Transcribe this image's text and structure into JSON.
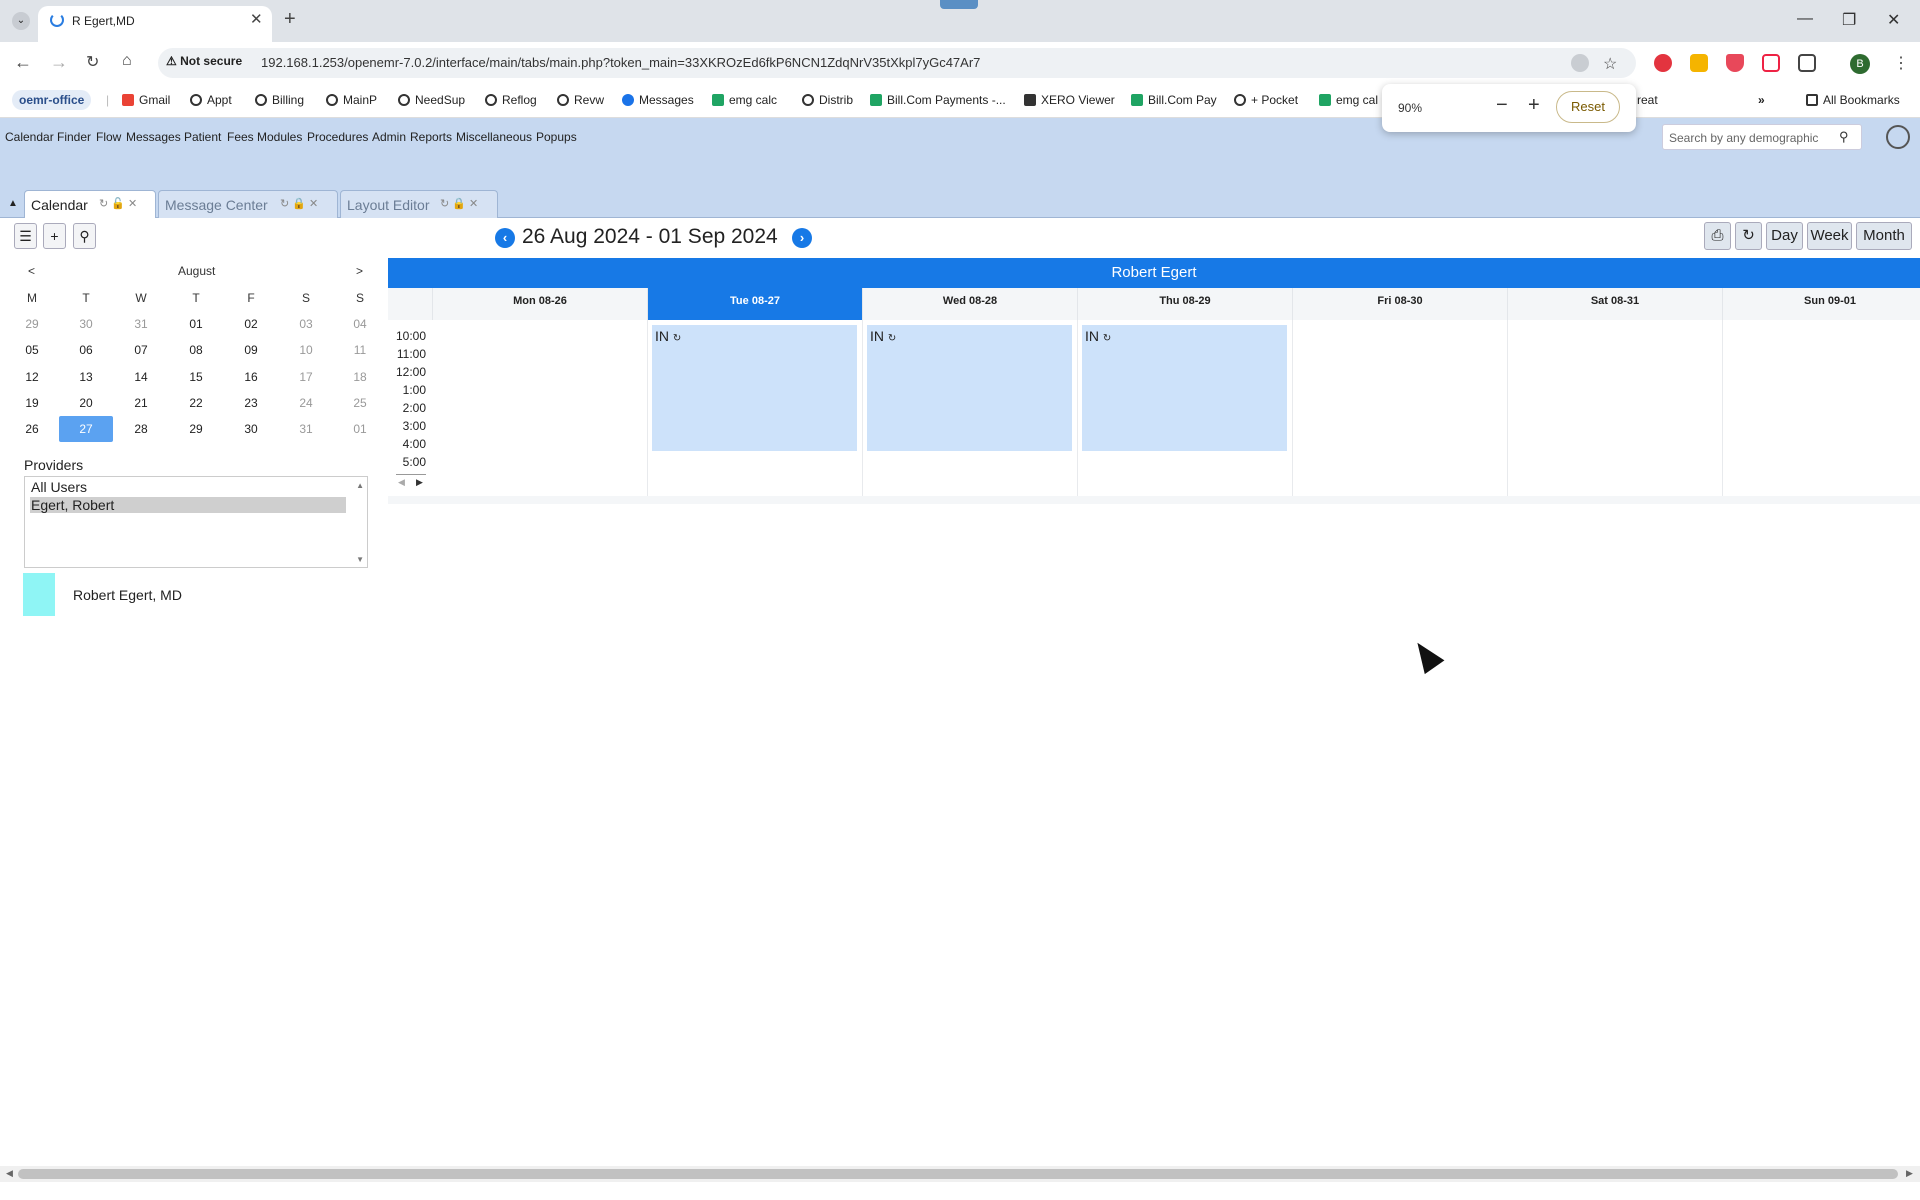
{
  "browser": {
    "tab_title": "R Egert,MD",
    "url": "192.168.1.253/openemr-7.0.2/interface/main/tabs/main.php?token_main=33XKROzEd6fkP6NCN1ZdqNrV35tXkpl7yGc47Ar7",
    "security_label": "Not secure",
    "profile_initial": "B",
    "zoom": {
      "value": "90%",
      "reset_label": "Reset"
    },
    "bookmarks": [
      "oemr-office",
      "Gmail",
      "Appt",
      "Billing",
      "MainP",
      "NeedSup",
      "Reflog",
      "Revw",
      "Messages",
      "emg calc",
      "Distrib",
      "Bill.Com Payments -...",
      "XERO Viewer",
      "Bill.Com Pay",
      "+ Pocket",
      "emg cal",
      "reat"
    ],
    "all_bookmarks_label": "All Bookmarks"
  },
  "emr": {
    "menu": [
      "Calendar",
      "Finder",
      "Flow",
      "Messages",
      "Patient",
      "Fees",
      "Modules",
      "Procedures",
      "Admin",
      "Reports",
      "Miscellaneous",
      "Popups"
    ],
    "search_placeholder": "Search by any demographic",
    "tabs": [
      {
        "label": "Calendar",
        "active": true
      },
      {
        "label": "Message Center",
        "active": false
      },
      {
        "label": "Layout Editor",
        "active": false
      }
    ]
  },
  "calendar": {
    "range_title": "26 Aug 2024 - 01 Sep 2024",
    "view_buttons": {
      "day": "Day",
      "week": "Week",
      "month": "Month"
    },
    "mini": {
      "month": "August",
      "prev": "<",
      "next": ">",
      "weekdays": [
        "M",
        "T",
        "W",
        "T",
        "F",
        "S",
        "S"
      ],
      "weeks": [
        [
          "29",
          "30",
          "31",
          "01",
          "02",
          "03",
          "04"
        ],
        [
          "05",
          "06",
          "07",
          "08",
          "09",
          "10",
          "11"
        ],
        [
          "12",
          "13",
          "14",
          "15",
          "16",
          "17",
          "18"
        ],
        [
          "19",
          "20",
          "21",
          "22",
          "23",
          "24",
          "25"
        ],
        [
          "26",
          "27",
          "28",
          "29",
          "30",
          "31",
          "01"
        ]
      ],
      "today": "27"
    },
    "providers_label": "Providers",
    "providers": [
      {
        "label": "All Users",
        "selected": false
      },
      {
        "label": "Egert, Robert",
        "selected": true
      }
    ],
    "legend": {
      "label": "Robert Egert, MD",
      "color": "#8ff5f5"
    },
    "provider_header": "Robert Egert",
    "days": [
      "Mon 08-26",
      "Tue 08-27",
      "Wed 08-28",
      "Thu 08-29",
      "Fri 08-30",
      "Sat 08-31",
      "Sun 09-01"
    ],
    "today_day": "Tue 08-27",
    "times": [
      "10:00",
      "11:00",
      "12:00",
      "1:00",
      "2:00",
      "3:00",
      "4:00",
      "5:00"
    ],
    "events": [
      {
        "day": "Tue 08-27",
        "label": "IN",
        "icon": "recurring-icon"
      },
      {
        "day": "Wed 08-28",
        "label": "IN",
        "icon": "recurring-icon"
      },
      {
        "day": "Thu 08-29",
        "label": "IN",
        "icon": "recurring-icon"
      }
    ],
    "colors": {
      "primary": "#1779e6",
      "event": "#cde2fa",
      "menu_bg": "#c6d8f0"
    }
  }
}
